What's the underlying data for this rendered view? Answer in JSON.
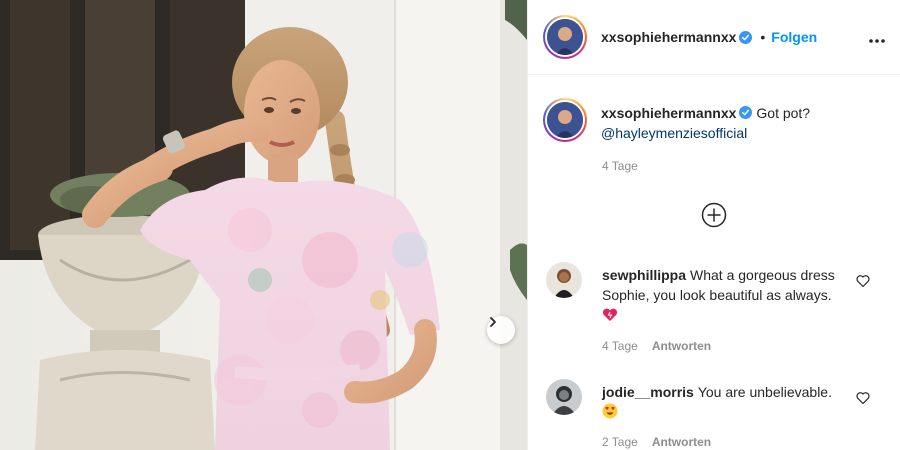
{
  "post": {
    "username": "xxsophiehermannxx",
    "follow_label": "Folgen",
    "dot": "•",
    "more_icon": "more-horizontal-icon",
    "caption": {
      "username": "xxsophiehermannxx",
      "text": "Got pot?",
      "mention": "@hayleymenziesofficial",
      "time": "4 Tage"
    }
  },
  "comments": [
    {
      "username": "sewphillippa",
      "text": "What a gorgeous dress Sophie, you look beautiful as always.",
      "time": "4 Tage",
      "reply_label": "Antworten"
    },
    {
      "username": "jodie__morris",
      "text": "You are unbelievable.",
      "time": "2 Tage",
      "reply_label": "Antworten"
    }
  ],
  "colors": {
    "link": "#0095f6",
    "mention": "#00376b",
    "muted": "#8e8e8e"
  }
}
